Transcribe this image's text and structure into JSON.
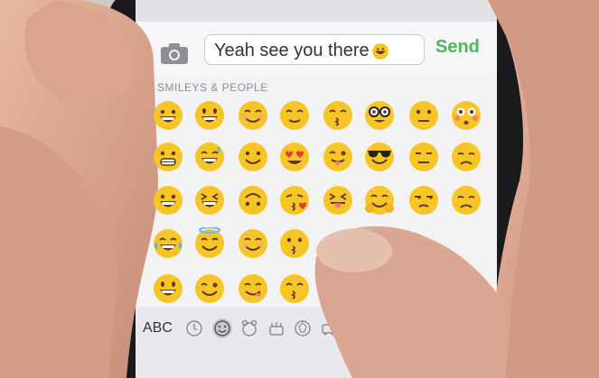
{
  "message_field": {
    "value": "Yeah see you there"
  },
  "send_label": "Send",
  "section_header": "SMILEYS & PEOPLE",
  "keyboard": {
    "abc_label": "ABC"
  },
  "categories": [
    "recent-icon",
    "smileys-icon",
    "animals-icon",
    "food-icon",
    "activity-icon",
    "travel-icon"
  ],
  "emoji_rows": [
    [
      "grinning-face",
      "grinning-face-big-eyes",
      "smiling-face",
      "relieved-face",
      "kissing-face-smiling-eyes",
      "nerd-face",
      "neutral-face",
      "flushed-face"
    ],
    [
      "grimacing-face",
      "sweat-smile-face",
      "slight-smile-face",
      "heart-eyes-face",
      "winking-tongue-face",
      "sunglasses-face",
      "expressionless-face",
      "disappointed-face"
    ],
    [
      "big-grin-face",
      "squinting-laugh-face",
      "upside-down-face",
      "kissing-heart-face",
      "squinting-tongue-face",
      "hugging-face",
      "unamused-face",
      "worried-face"
    ],
    [
      "tears-of-joy-face",
      "halo-face",
      "blushing-face",
      "kissing-face",
      "hidden",
      "hidden",
      "hidden",
      "hidden"
    ],
    [
      "smiley-face",
      "wink-face",
      "yum-face",
      "kissing-closed-eyes-face"
    ]
  ],
  "colors": {
    "send": "#4cb85c",
    "emoji_fill": "#f7c526",
    "keyboard_bg": "#e8e9ed"
  }
}
